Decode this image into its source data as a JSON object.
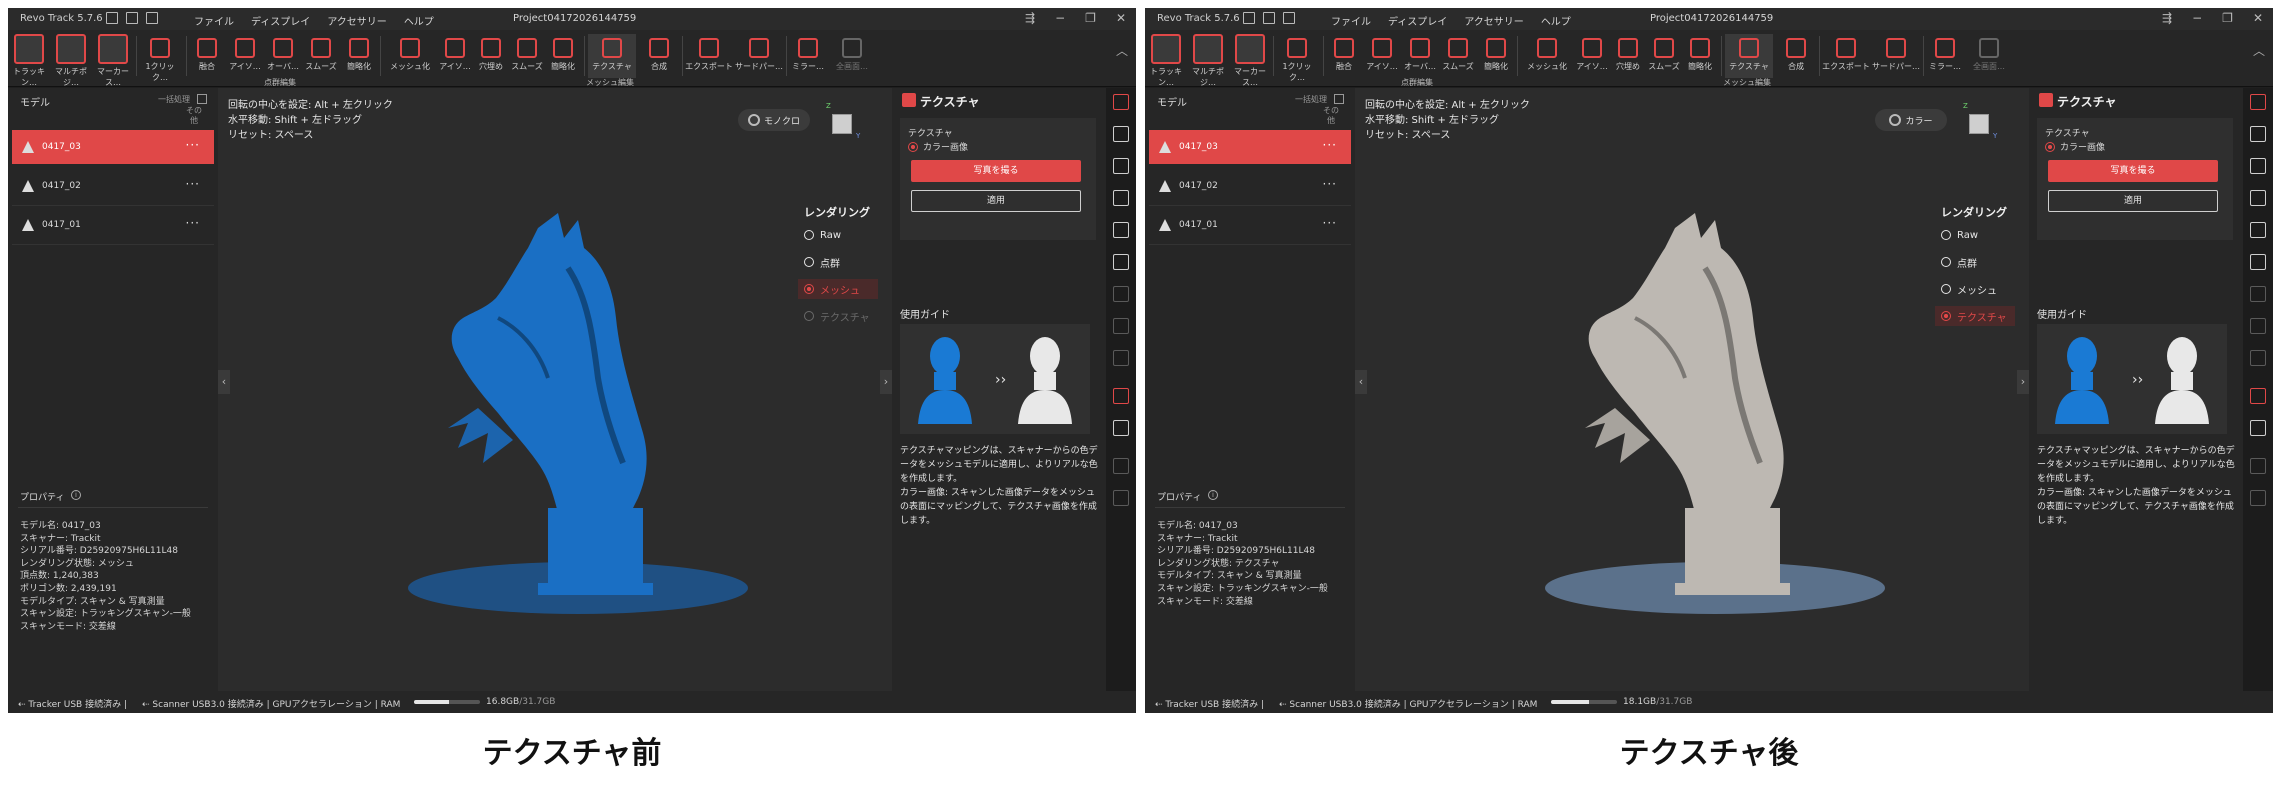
{
  "captions": {
    "left": "テクスチャ前",
    "right": "テクスチャ後"
  },
  "app": {
    "name": "Revo Track 5.7.6",
    "project": "Project04172026144759",
    "menus": [
      "ファイル",
      "ディスプレイ",
      "アクセサリー",
      "ヘルプ"
    ]
  },
  "toolbar": {
    "tools": [
      "トラッキン…",
      "マルチポジ…",
      "マーカース…",
      "1クリック…",
      "融合",
      "アイソ…",
      "オーバ…",
      "スムーズ",
      "簡略化",
      "メッシュ化",
      "アイソ…",
      "穴埋め",
      "スムーズ",
      "簡略化",
      "テクスチャ",
      "合成",
      "エクスポート",
      "サードパー…",
      "ミラー…",
      "全画面…"
    ],
    "groups": {
      "point_edit": "点群編集",
      "mesh_edit": "メッシュ編集"
    }
  },
  "left_panel": {
    "title": "モデル",
    "batch": "一括処理",
    "other": "その他",
    "models": [
      "0417_03",
      "0417_02",
      "0417_01"
    ],
    "properties_title": "プロパティ"
  },
  "viewport": {
    "hints": [
      "回転の中心を設定: Alt + 左クリック",
      "水平移動: Shift + 左ドラッグ",
      "リセット: スペース"
    ],
    "rendering_title": "レンダリング",
    "rendering_options": [
      "Raw",
      "点群",
      "メッシュ",
      "テクスチャ"
    ]
  },
  "texture_panel": {
    "title": "テクスチャ",
    "subtitle": "テクスチャ",
    "radio": "カラー画像",
    "photo_button": "写真を撮る",
    "apply_button": "適用",
    "guide_title": "使用ガイド",
    "desc": [
      "テクスチャマッピングは、スキャナーからの色データをメッシュモデルに適用し、よりリアルな色を作成します。",
      "カラー画像: スキャンした画像データをメッシュの表面にマッピングして、テクスチャ画像を作成します。"
    ]
  },
  "status": {
    "tracker": "Tracker USB 接続済み",
    "scanner": "Scanner USB3.0 接続済み",
    "gpu": "GPUアクセラレーション",
    "ram_label": "RAM"
  },
  "before": {
    "mode_label": "モノクロ",
    "render_selected": 2,
    "ram_used": "16.8GB",
    "ram_total": "/31.7GB",
    "ram_fraction": 0.53,
    "mesh_color": "#1a6fc4",
    "properties": [
      "モデル名: 0417_03",
      "スキャナー: Trackit",
      "シリアル番号: D25920975H6L11L48",
      "レンダリング状態: メッシュ",
      "頂点数: 1,240,383",
      "ポリゴン数: 2,439,191",
      "モデルタイプ: スキャン & 写真測量",
      "スキャン設定: トラッキングスキャン-一般",
      "スキャンモード: 交差線"
    ]
  },
  "after": {
    "mode_label": "カラー",
    "render_selected": 3,
    "ram_used": "18.1GB",
    "ram_total": "/31.7GB",
    "ram_fraction": 0.57,
    "mesh_color": "#bdb8b2",
    "properties": [
      "モデル名: 0417_03",
      "スキャナー: Trackit",
      "シリアル番号: D25920975H6L11L48",
      "レンダリング状態: テクスチャ",
      "モデルタイプ: スキャン & 写真測量",
      "スキャン設定: トラッキングスキャン-一般",
      "スキャンモード: 交差線"
    ]
  },
  "colors": {
    "accent": "#e04848",
    "bg": "#1f1f1f",
    "panel": "#262626",
    "viewport": "#2c2c2c"
  }
}
